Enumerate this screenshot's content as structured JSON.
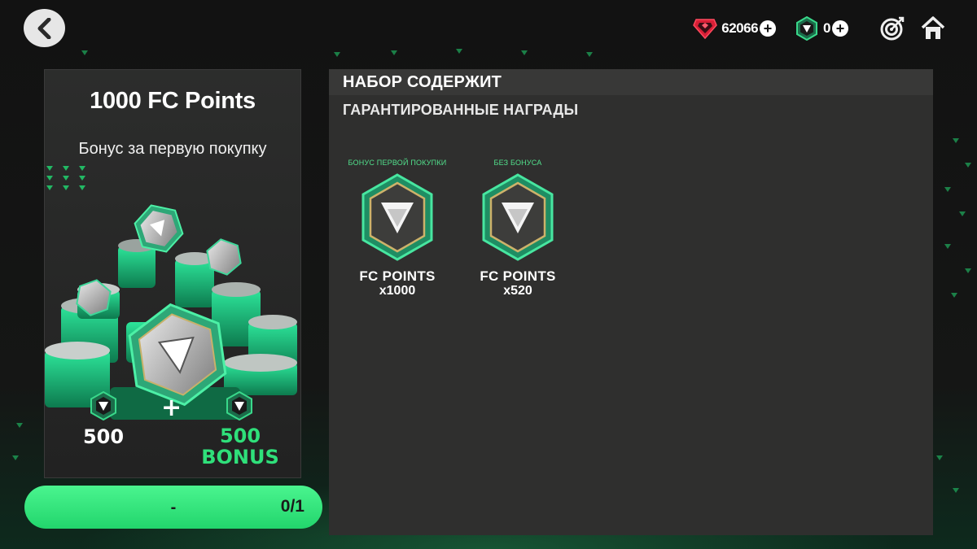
{
  "topbar": {
    "back_icon": "chevron-left-icon",
    "currency_1": {
      "icon": "ruby-gem-icon",
      "value": "62066",
      "color": "#e0203a"
    },
    "currency_2": {
      "icon": "fc-points-icon",
      "value": "0",
      "color": "#27c27a"
    },
    "objectives_icon": "target-icon",
    "home_icon": "home-icon"
  },
  "offer": {
    "title": "1000 FC Points",
    "subtitle": "Бонус за первую покупку",
    "base_amount": "500",
    "plus": "+",
    "bonus_amount": "500",
    "bonus_label": "BONUS",
    "bonus_color": "#2fe07a"
  },
  "buy_button": {
    "price": "-",
    "count": "0/1",
    "color": "#33e07a"
  },
  "panel": {
    "header": "НАБОР СОДЕРЖИТ",
    "section_title": "ГАРАНТИРОВАННЫЕ НАГРАДЫ",
    "rewards": [
      {
        "tag": "БОНУС ПЕРВОЙ ПОКУПКИ",
        "name": "FC POINTS",
        "qty": "x1000",
        "icon": "fc-points-badge-icon"
      },
      {
        "tag": "БЕЗ БОНУСА",
        "name": "FC POINTS",
        "qty": "x520",
        "icon": "fc-points-badge-icon"
      }
    ]
  }
}
